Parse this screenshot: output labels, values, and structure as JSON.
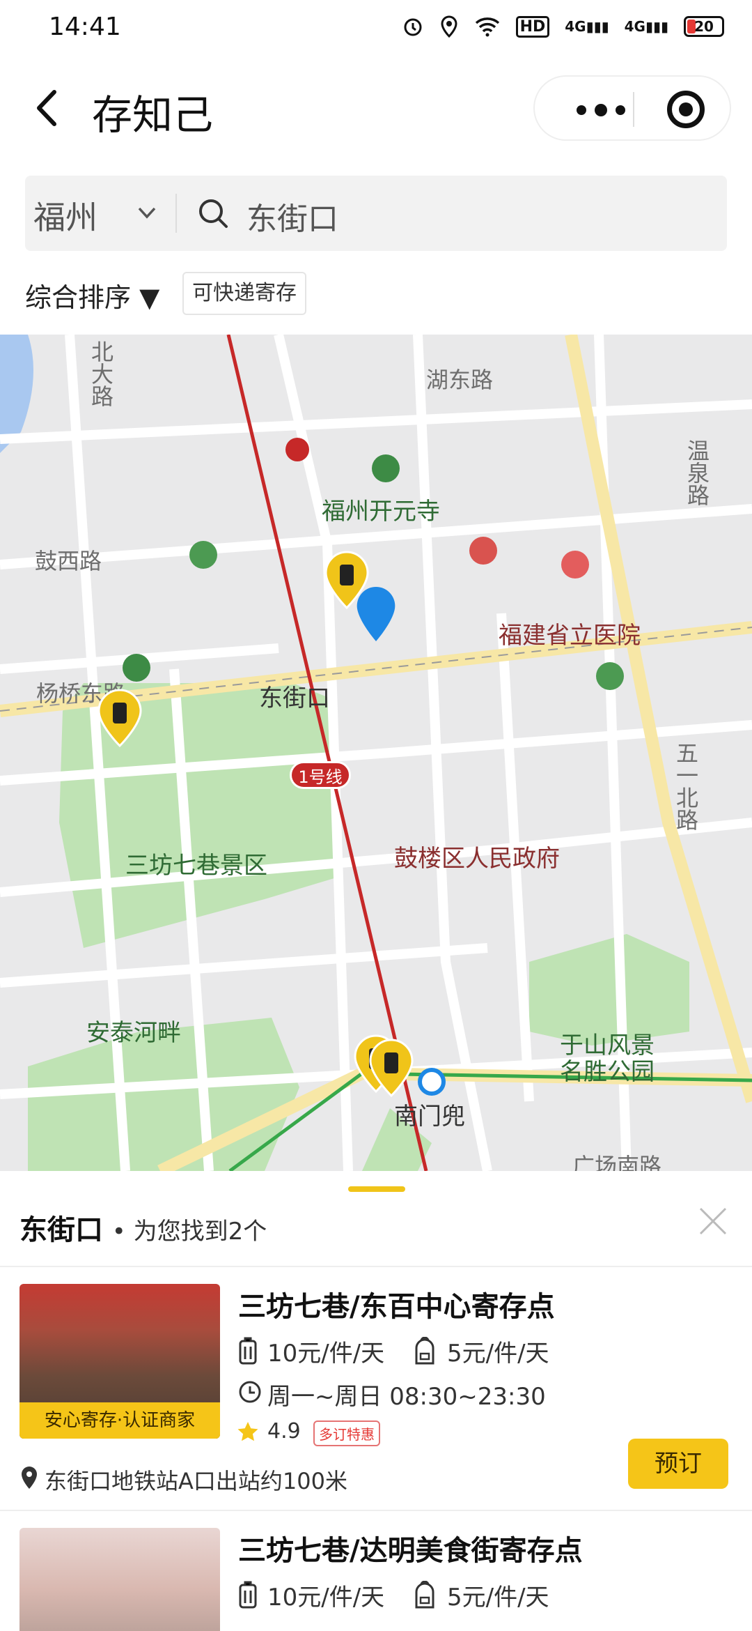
{
  "status_bar": {
    "time": "14:41",
    "network": "4G",
    "network2": "4G",
    "hd": "HD",
    "battery": "20"
  },
  "nav": {
    "title": "存知己"
  },
  "search": {
    "city": "福州",
    "query": "东街口"
  },
  "filters": {
    "sort_label": "综合排序 ▼",
    "express_label": "可快递寄存"
  },
  "map": {
    "labels": {
      "north_road": "北大路",
      "hudong_road": "湖东路",
      "wenquan_road": "温泉路",
      "kaiyuan_temple": "福州开元寺",
      "guxi_road": "鼓西路",
      "provincial_hospital": "福建省立医院",
      "yangqiao_road": "杨桥东路",
      "dongjiekou": "东街口",
      "line1": "1号线",
      "wuyi_north": "五一北路",
      "sanfang": "三坊七巷景区",
      "gulou_gov": "鼓楼区人民政府",
      "antai": "安泰河畔",
      "yushan_1": "于山风景",
      "yushan_2": "名胜公园",
      "nanmendou": "南门兜",
      "guangchang_south": "广场南路"
    },
    "colors": {
      "metro": "#c62828",
      "pin": "#f0c419",
      "user": "#1e88e5",
      "park": "#bfe3b4"
    }
  },
  "results": {
    "location": "东街口",
    "summary": "为您找到2个",
    "items": [
      {
        "title": "三坊七巷/东百中心寄存点",
        "price_luggage": "10元/件/天",
        "price_bag": "5元/件/天",
        "hours": "周一~周日 08:30~23:30",
        "rating": "4.9",
        "promo": "多订特惠",
        "badge": "安心寄存·认证商家",
        "location_note": "东街口地铁站A口出站约100米",
        "book_label": "预订"
      },
      {
        "title": "三坊七巷/达明美食街寄存点",
        "price_luggage": "10元/件/天",
        "price_bag": "5元/件/天"
      }
    ]
  }
}
